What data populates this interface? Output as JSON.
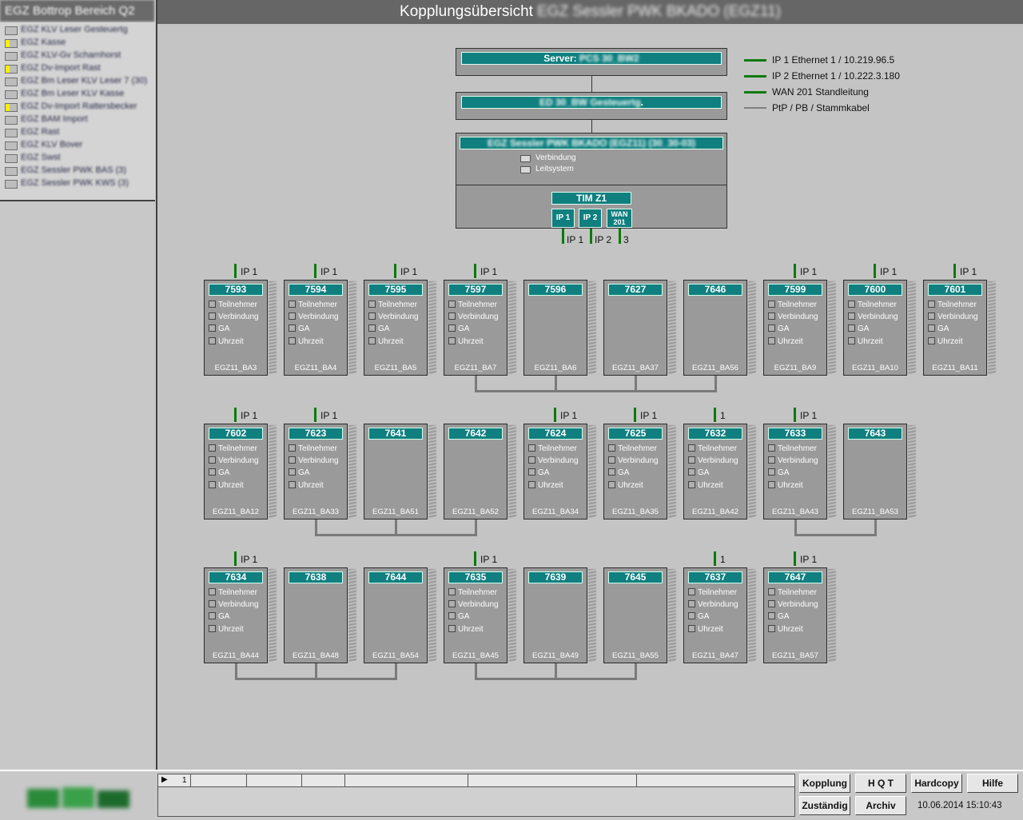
{
  "sidebar": {
    "title": "EGZ Bottrop Bereich Q2",
    "items": [
      {
        "label": "EGZ KLV Leser Gesteuertg",
        "flag": false
      },
      {
        "label": "EGZ Kasse",
        "flag": true
      },
      {
        "label": "EGZ KLV-Gv Scharnhorst",
        "flag": false
      },
      {
        "label": "EGZ Dv-Import Rast",
        "flag": true
      },
      {
        "label": "EGZ Bm Leser KLV Leser 7 (30)",
        "flag": false
      },
      {
        "label": "EGZ Bm Leser KLV Kasse",
        "flag": false
      },
      {
        "label": "EGZ Dv-Import Rattersbecker",
        "flag": true
      },
      {
        "label": "EGZ BAM Import",
        "flag": false
      },
      {
        "label": "EGZ Rast",
        "flag": false
      },
      {
        "label": "EGZ KLV Bover",
        "flag": false
      },
      {
        "label": "EGZ Swst",
        "flag": false
      },
      {
        "label": "EGZ Sessler PWK BAS (3)",
        "flag": false
      },
      {
        "label": "EGZ Sessler PWK KWS (3)",
        "flag": false
      }
    ]
  },
  "header": {
    "title": "Kopplungsübersicht",
    "subtitle": "EGZ Sessler PWK BKADO (EGZ11)"
  },
  "topology": {
    "server_label": "Server:",
    "server_name": "PCS 30_BW2",
    "gateway_name": "ED 30_BW Gesteuertg",
    "gateway_suffix": ".",
    "station_name": "EGZ Sessler PWK BKADO (EGZ11) (30_30-03)",
    "chk_verbindung": "Verbindung",
    "chk_leitsystem": "Leitsystem",
    "tim_label": "TIM Z1",
    "port1": "IP 1",
    "port2": "IP 2",
    "port3_line1": "WAN",
    "port3_line2": "201",
    "port_out1": "IP 1",
    "port_out2": "IP 2",
    "port_out3": "3"
  },
  "legend": [
    {
      "text": "IP 1 Ethernet 1 / 10.219.96.5",
      "color": "#0a7a0a"
    },
    {
      "text": "IP 2 Ethernet 1 / 10.222.3.180",
      "color": "#0a7a0a"
    },
    {
      "text": "WAN 201 Standleitung",
      "color": "#0a7a0a"
    },
    {
      "text": "PtP / PB / Stammkabel",
      "color": "#808080"
    }
  ],
  "row_labels": {
    "teilnehmer": "Teilnehmer",
    "verbindung": "Verbindung",
    "ga": "GA",
    "uhrzeit": "Uhrzeit"
  },
  "stations": [
    [
      {
        "num": "7593",
        "name": "EGZ11_BA3",
        "link": "IP 1",
        "checks": true
      },
      {
        "num": "7594",
        "name": "EGZ11_BA4",
        "link": "IP 1",
        "checks": true
      },
      {
        "num": "7595",
        "name": "EGZ11_BA5",
        "link": "IP 1",
        "checks": true
      },
      {
        "num": "7597",
        "name": "EGZ11_BA7",
        "link": "IP 1",
        "checks": true
      },
      {
        "num": "7596",
        "name": "EGZ11_BA6",
        "link": "",
        "checks": false
      },
      {
        "num": "7627",
        "name": "EGZ11_BA37",
        "link": "",
        "checks": false
      },
      {
        "num": "7646",
        "name": "EGZ11_BA56",
        "link": "",
        "checks": false
      },
      {
        "num": "7599",
        "name": "EGZ11_BA9",
        "link": "IP 1",
        "checks": true
      },
      {
        "num": "7600",
        "name": "EGZ11_BA10",
        "link": "IP 1",
        "checks": true
      },
      {
        "num": "7601",
        "name": "EGZ11_BA11",
        "link": "IP 1",
        "checks": true
      }
    ],
    [
      {
        "num": "7602",
        "name": "EGZ11_BA12",
        "link": "IP 1",
        "checks": true
      },
      {
        "num": "7623",
        "name": "EGZ11_BA33",
        "link": "IP 1",
        "checks": true
      },
      {
        "num": "7641",
        "name": "EGZ11_BA51",
        "link": "",
        "checks": false
      },
      {
        "num": "7642",
        "name": "EGZ11_BA52",
        "link": "",
        "checks": false
      },
      {
        "num": "7624",
        "name": "EGZ11_BA34",
        "link": "IP 1",
        "checks": true
      },
      {
        "num": "7625",
        "name": "EGZ11_BA35",
        "link": "IP 1",
        "checks": true
      },
      {
        "num": "7632",
        "name": "EGZ11_BA42",
        "link": "1",
        "checks": true
      },
      {
        "num": "7633",
        "name": "EGZ11_BA43",
        "link": "IP 1",
        "checks": true
      },
      {
        "num": "7643",
        "name": "EGZ11_BA53",
        "link": "",
        "checks": false
      }
    ],
    [
      {
        "num": "7634",
        "name": "EGZ11_BA44",
        "link": "IP 1",
        "checks": true
      },
      {
        "num": "7638",
        "name": "EGZ11_BA48",
        "link": "",
        "checks": false
      },
      {
        "num": "7644",
        "name": "EGZ11_BA54",
        "link": "",
        "checks": false
      },
      {
        "num": "7635",
        "name": "EGZ11_BA45",
        "link": "IP 1",
        "checks": true
      },
      {
        "num": "7639",
        "name": "EGZ11_BA49",
        "link": "",
        "checks": false
      },
      {
        "num": "7645",
        "name": "EGZ11_BA55",
        "link": "",
        "checks": false
      },
      {
        "num": "7637",
        "name": "EGZ11_BA47",
        "link": "1",
        "checks": true
      },
      {
        "num": "7647",
        "name": "EGZ11_BA57",
        "link": "IP 1",
        "checks": true
      }
    ]
  ],
  "connections": [
    {
      "row": 0,
      "from": 3,
      "to": 6
    },
    {
      "row": 1,
      "from": 1,
      "to": 3
    },
    {
      "row": 1,
      "from": 7,
      "to": 8
    },
    {
      "row": 2,
      "from": 0,
      "to": 2
    },
    {
      "row": 2,
      "from": 3,
      "to": 5
    }
  ],
  "bottom": {
    "logo_text": "ESB",
    "grid_row_num": "1",
    "buttons": {
      "kopplung": "Kopplung",
      "hqt": "H Q T",
      "hardcopy": "Hardcopy",
      "hilfe": "Hilfe",
      "zustaendig": "Zuständig",
      "archiv": "Archiv"
    },
    "datetime": "10.06.2014 15:10:43"
  }
}
